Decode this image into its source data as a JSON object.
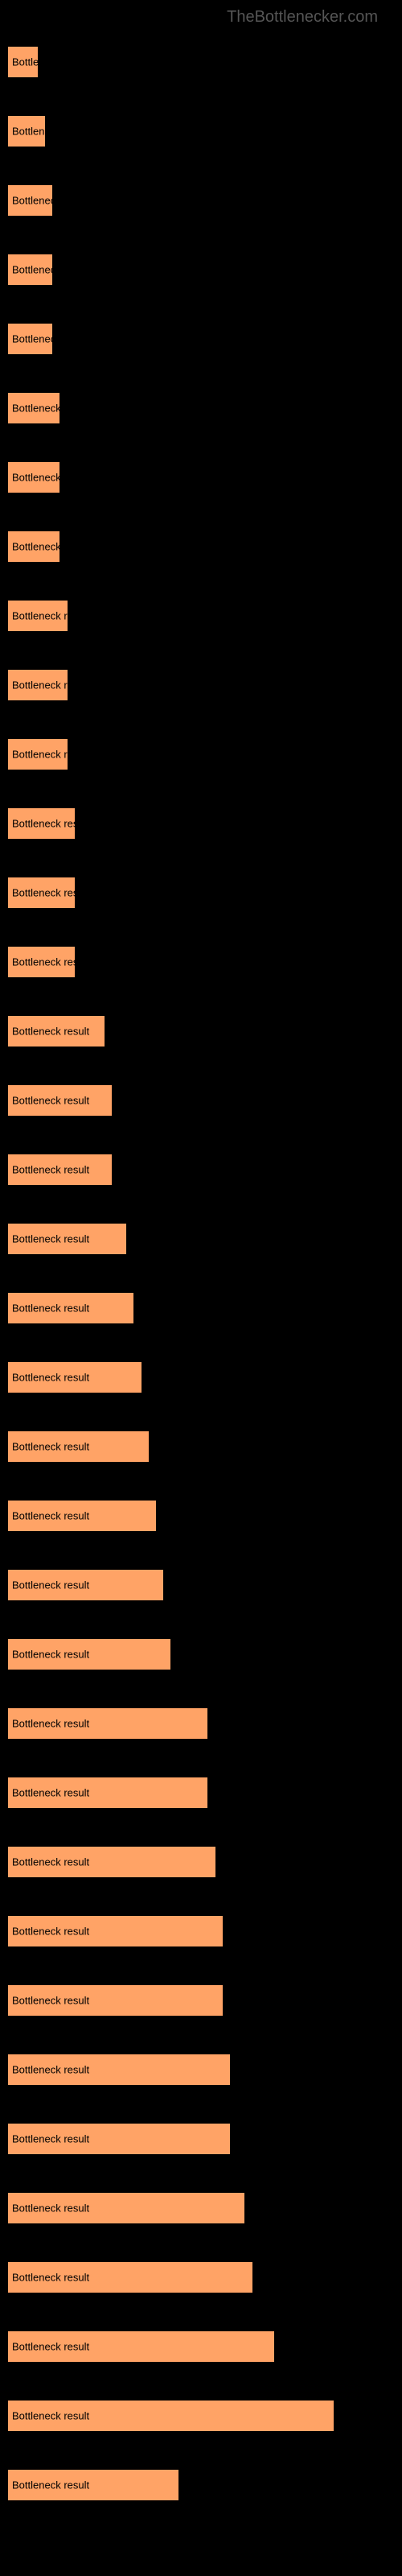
{
  "watermark": "TheBottlenecker.com",
  "chart_data": {
    "type": "bar",
    "bar_label": "Bottleneck result",
    "bar_color": "#ffa366",
    "xlim": [
      0,
      480
    ],
    "max_value": 50,
    "items": [
      {
        "value": 4
      },
      {
        "value": 5
      },
      {
        "value": 6
      },
      {
        "value": 6
      },
      {
        "value": 6
      },
      {
        "value": 7
      },
      {
        "value": 7
      },
      {
        "value": 7
      },
      {
        "value": 8
      },
      {
        "value": 8
      },
      {
        "value": 8
      },
      {
        "value": 9
      },
      {
        "value": 9
      },
      {
        "value": 9
      },
      {
        "value": 13
      },
      {
        "value": 14
      },
      {
        "value": 14
      },
      {
        "value": 16
      },
      {
        "value": 17
      },
      {
        "value": 18
      },
      {
        "value": 19
      },
      {
        "value": 20
      },
      {
        "value": 21
      },
      {
        "value": 22
      },
      {
        "value": 27
      },
      {
        "value": 27
      },
      {
        "value": 28
      },
      {
        "value": 29
      },
      {
        "value": 29
      },
      {
        "value": 30
      },
      {
        "value": 30
      },
      {
        "value": 32
      },
      {
        "value": 33
      },
      {
        "value": 36
      },
      {
        "value": 44
      },
      {
        "value": 23
      }
    ]
  }
}
